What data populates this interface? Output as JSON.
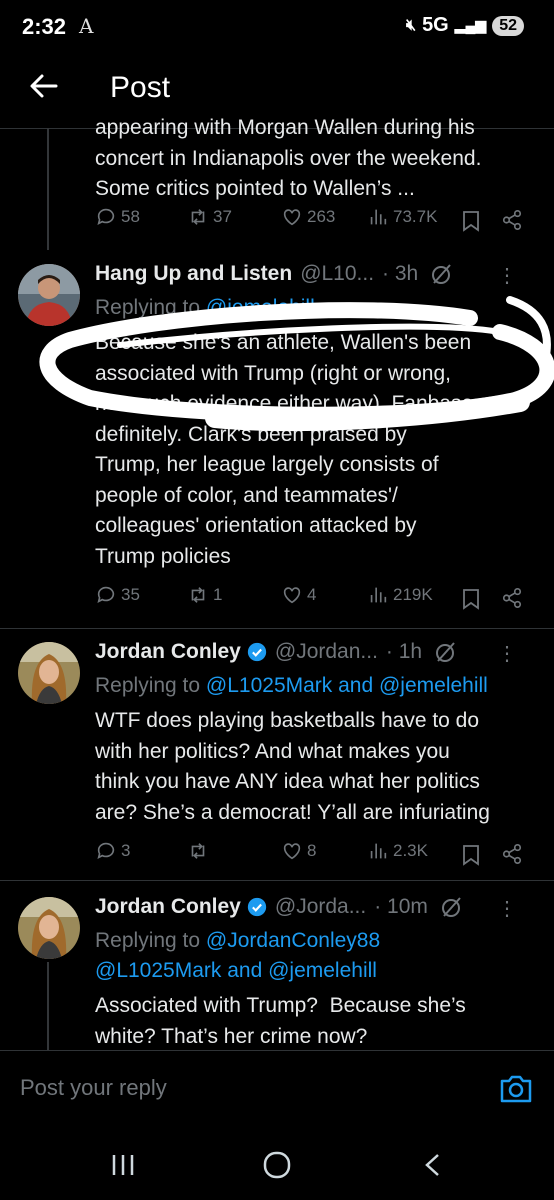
{
  "status_bar": {
    "time": "2:32",
    "a_icon": "A",
    "network": "5G",
    "battery": "52"
  },
  "header": {
    "title": "Post"
  },
  "tweets": [
    {
      "text_lines": [
        "appearing with Morgan Wallen during his",
        "concert in Indianapolis over the weekend.",
        "Some critics pointed to Wallen’s ..."
      ],
      "stats": {
        "replies": "58",
        "reposts": "37",
        "likes": "263",
        "views": "73.7K"
      }
    },
    {
      "name": "Hang Up and Listen",
      "handle": "@L10...",
      "time": "· 3h",
      "replying_prefix": "Replying to ",
      "replying_to": "@jemelehill",
      "text_lines": [
        "Because she's an athlete, Wallen's been",
        "associated with Trump (right or wrong,",
        "not much evidence either way). Fanbase",
        "definitely. Clark's been praised by",
        "Trump, her league largely consists of",
        "people of color, and teammates'/",
        "colleagues' orientation attacked by",
        "Trump policies"
      ],
      "stats": {
        "replies": "35",
        "reposts": "1",
        "likes": "4",
        "views": "219K"
      }
    },
    {
      "name": "Jordan Conley",
      "handle": "@Jordan...",
      "time": "· 1h",
      "replying_prefix": "Replying to ",
      "replying_to": "@L1025Mark and @jemelehill",
      "text_lines": [
        "WTF does playing basketballs have to do",
        "with her politics? And what makes you",
        "think you have ANY idea what her politics",
        "are? She’s a democrat! Y’all are infuriating"
      ],
      "stats": {
        "replies": "3",
        "reposts": "",
        "likes": "8",
        "views": "2.3K"
      }
    },
    {
      "name": "Jordan Conley",
      "handle": "@Jorda...",
      "time": "· 10m",
      "replying_prefix": "Replying to ",
      "replying_to_line1": "@JordanConley88",
      "replying_to_line2": "@L1025Mark and @jemelehill",
      "text_lines": [
        "Associated with Trump?  Because she’s",
        "white? That’s her crime now?"
      ]
    }
  ],
  "composer": {
    "placeholder": "Post your reply"
  },
  "colors": {
    "accent": "#1d9bf0",
    "muted": "#71767b",
    "text": "#e7e9ea",
    "background": "#000000"
  }
}
